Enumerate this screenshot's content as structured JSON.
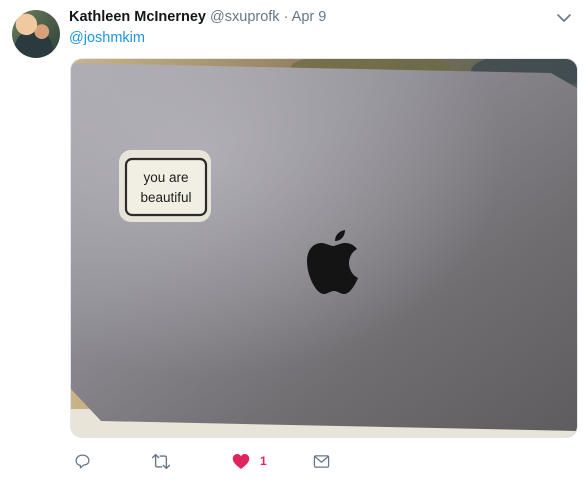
{
  "tweet": {
    "author_name": "Kathleen McInerney",
    "author_handle": "@sxuprofk",
    "separator": "·",
    "timestamp": "Apr 9",
    "reply_mention": "@joshmkim"
  },
  "image": {
    "sticker_line1": "you are",
    "sticker_line2": "beautiful"
  },
  "actions": {
    "like_count": "1"
  },
  "colors": {
    "link": "#1b95e0",
    "like": "#e0245e",
    "muted": "#657786"
  },
  "icons": [
    "reply-icon",
    "retweet-icon",
    "heart-icon",
    "direct-message-icon",
    "chevron-down-icon"
  ]
}
